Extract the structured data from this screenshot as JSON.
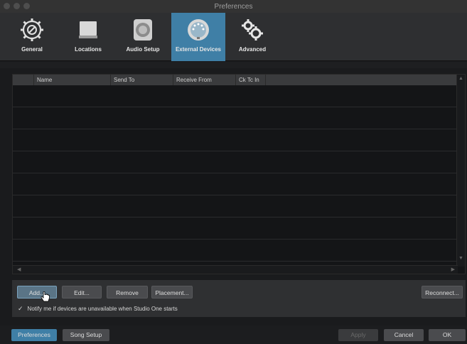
{
  "window": {
    "title": "Preferences"
  },
  "toolbar": {
    "tabs": [
      {
        "label": "General",
        "icon": "gear-circle-icon"
      },
      {
        "label": "Locations",
        "icon": "drive-icon"
      },
      {
        "label": "Audio Setup",
        "icon": "speaker-icon"
      },
      {
        "label": "External Devices",
        "icon": "midi-connector-icon",
        "active": true
      },
      {
        "label": "Advanced",
        "icon": "gears-icon"
      }
    ]
  },
  "table": {
    "columns": [
      "",
      "Name",
      "Send To",
      "Receive From",
      "Ck Tc In",
      ""
    ],
    "rows": []
  },
  "actions": {
    "add": "Add...",
    "edit": "Edit...",
    "remove": "Remove",
    "placement": "Placement...",
    "reconnect": "Reconnect...",
    "notify_checked": true,
    "notify_label": "Notify me if devices are unavailable when Studio One starts"
  },
  "footer": {
    "preferences": "Preferences",
    "song_setup": "Song Setup",
    "apply": "Apply",
    "cancel": "Cancel",
    "ok": "OK"
  },
  "colors": {
    "accent": "#3f7fa6",
    "background": "#1a1b1d"
  }
}
